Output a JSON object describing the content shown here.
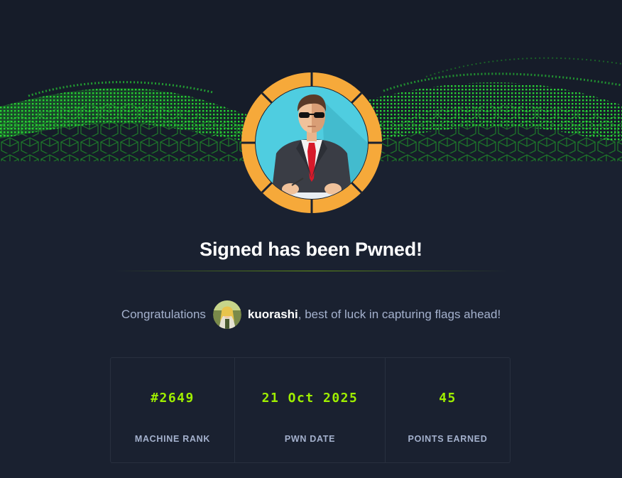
{
  "banner": {
    "accent_color": "#25d92f"
  },
  "machine": {
    "avatar_icon": "businessman-avatar-icon"
  },
  "headline": "Signed has been Pwned!",
  "congrats": {
    "prefix": "Congratulations",
    "username": "kuorashi",
    "suffix": ", best of luck in capturing flags ahead!",
    "user_avatar_icon": "user-avatar-icon"
  },
  "stats": [
    {
      "value": "#2649",
      "label": "MACHINE RANK"
    },
    {
      "value": "21 Oct 2025",
      "label": "PWN DATE"
    },
    {
      "value": "45",
      "label": "POINTS EARNED"
    }
  ],
  "colors": {
    "accent": "#9fef00",
    "background": "#1a2130",
    "muted_text": "#a4b1cd",
    "avatar_ring": "#f6a93a"
  }
}
